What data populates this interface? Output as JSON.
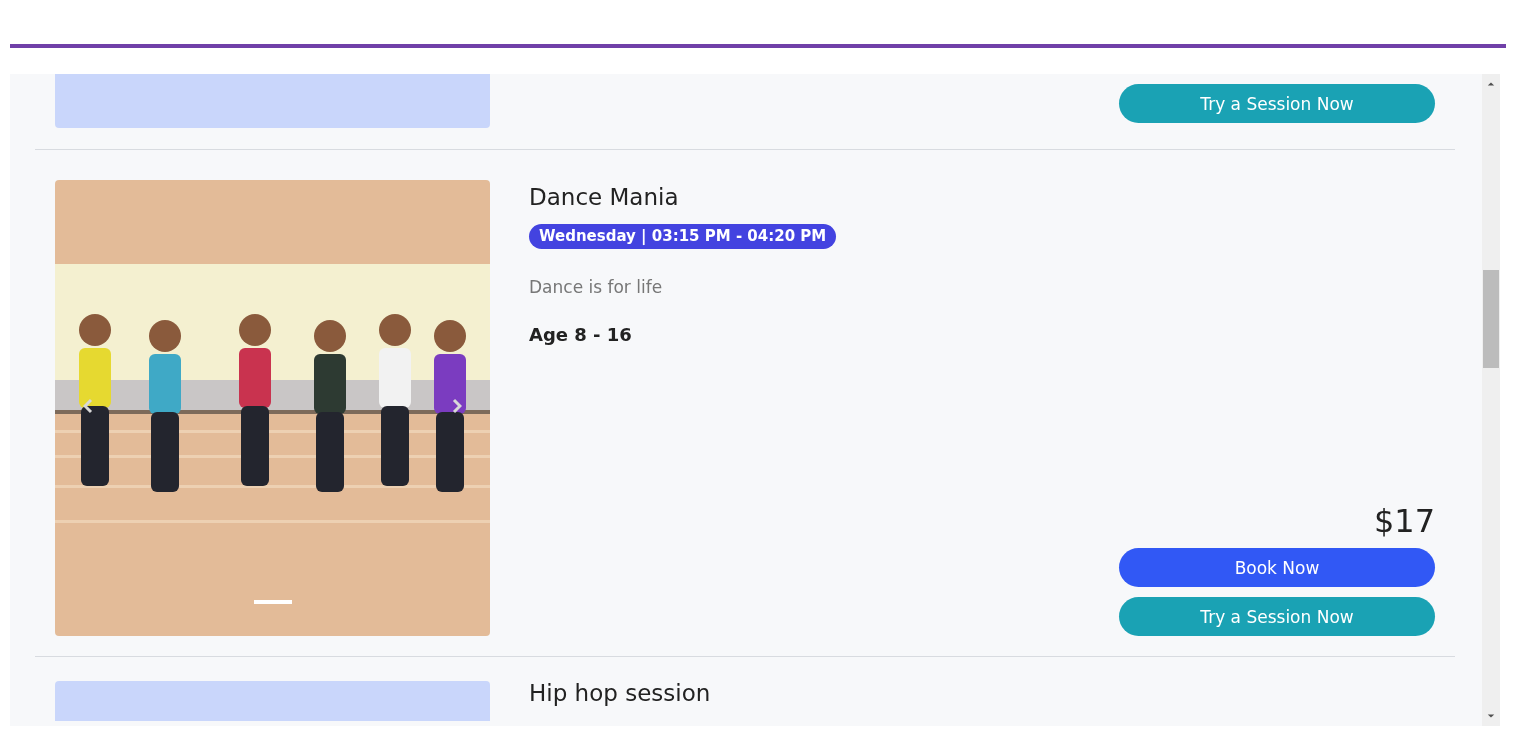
{
  "sessions": [
    {
      "kind": "partial",
      "image": {
        "kind": "placeholder"
      },
      "buttons": [
        {
          "kind": "try",
          "label": "Try a Session Now"
        }
      ]
    },
    {
      "kind": "full",
      "title": "Dance Mania",
      "schedule": "Wednesday | 03:15 PM - 04:20 PM",
      "description": "Dance is for life",
      "age": "Age 8 - 16",
      "price": "$17",
      "image": {
        "kind": "picture"
      },
      "slides": [
        {
          "selected": true
        }
      ],
      "buttons": [
        {
          "kind": "book",
          "label": "Book Now"
        },
        {
          "kind": "try",
          "label": "Try a Session Now"
        }
      ]
    },
    {
      "kind": "partial",
      "title": "Hip hop session",
      "image": {
        "kind": "placeholder"
      }
    }
  ]
}
